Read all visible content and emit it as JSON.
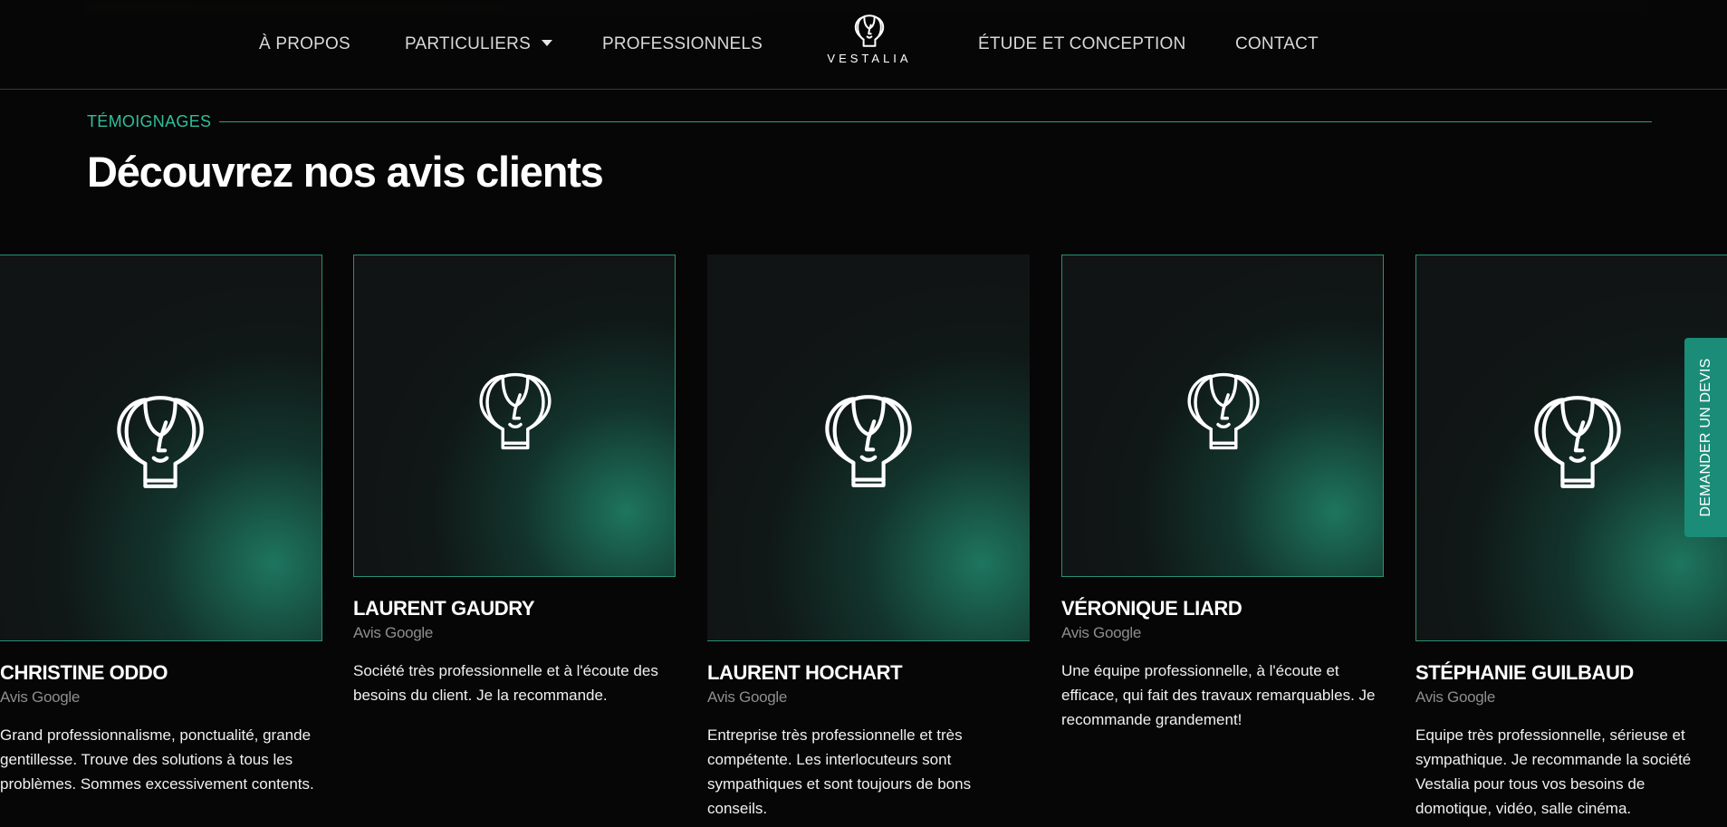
{
  "nav": {
    "items": [
      {
        "label": "À PROPOS"
      },
      {
        "label": "PARTICULIERS"
      },
      {
        "label": "PROFESSIONNELS"
      },
      {
        "label": "ÉTUDE ET CONCEPTION"
      },
      {
        "label": "CONTACT"
      }
    ],
    "logo_text": "VESTALIA"
  },
  "section": {
    "eyebrow": "TÉMOIGNAGES",
    "title": "Découvrez nos avis clients"
  },
  "reviews": [
    {
      "name": "CHRISTINE ODDO",
      "source": "Avis Google",
      "text": "Grand professionnalisme, ponctualité, grande gentillesse. Trouve des solutions à tous les problèmes. Sommes excessivement contents."
    },
    {
      "name": "LAURENT GAUDRY",
      "source": "Avis Google",
      "text": "Société très professionnelle et à l'écoute des besoins du client. Je la recommande."
    },
    {
      "name": "LAURENT HOCHART",
      "source": "Avis Google",
      "text": "Entreprise très professionnelle et très compétente. Les interlocuteurs sont sympathiques et sont toujours de bons conseils."
    },
    {
      "name": "VÉRONIQUE LIARD",
      "source": "Avis Google",
      "text": "Une équipe professionnelle, à l'écoute et efficace, qui fait des travaux remarquables. Je recommande grandement!"
    },
    {
      "name": "STÉPHANIE GUILBAUD",
      "source": "Avis Google",
      "text": "Equipe très professionnelle, sérieuse et sympathique. Je recommande la société Vestalia pour tous vos besoins de domotique, vidéo, salle cinéma."
    }
  ],
  "cta": {
    "label": "DEMANDER UN DEVIS"
  },
  "colors": {
    "accent": "#2fbf9b",
    "tab": "#1a8c78",
    "background": "#060606"
  }
}
